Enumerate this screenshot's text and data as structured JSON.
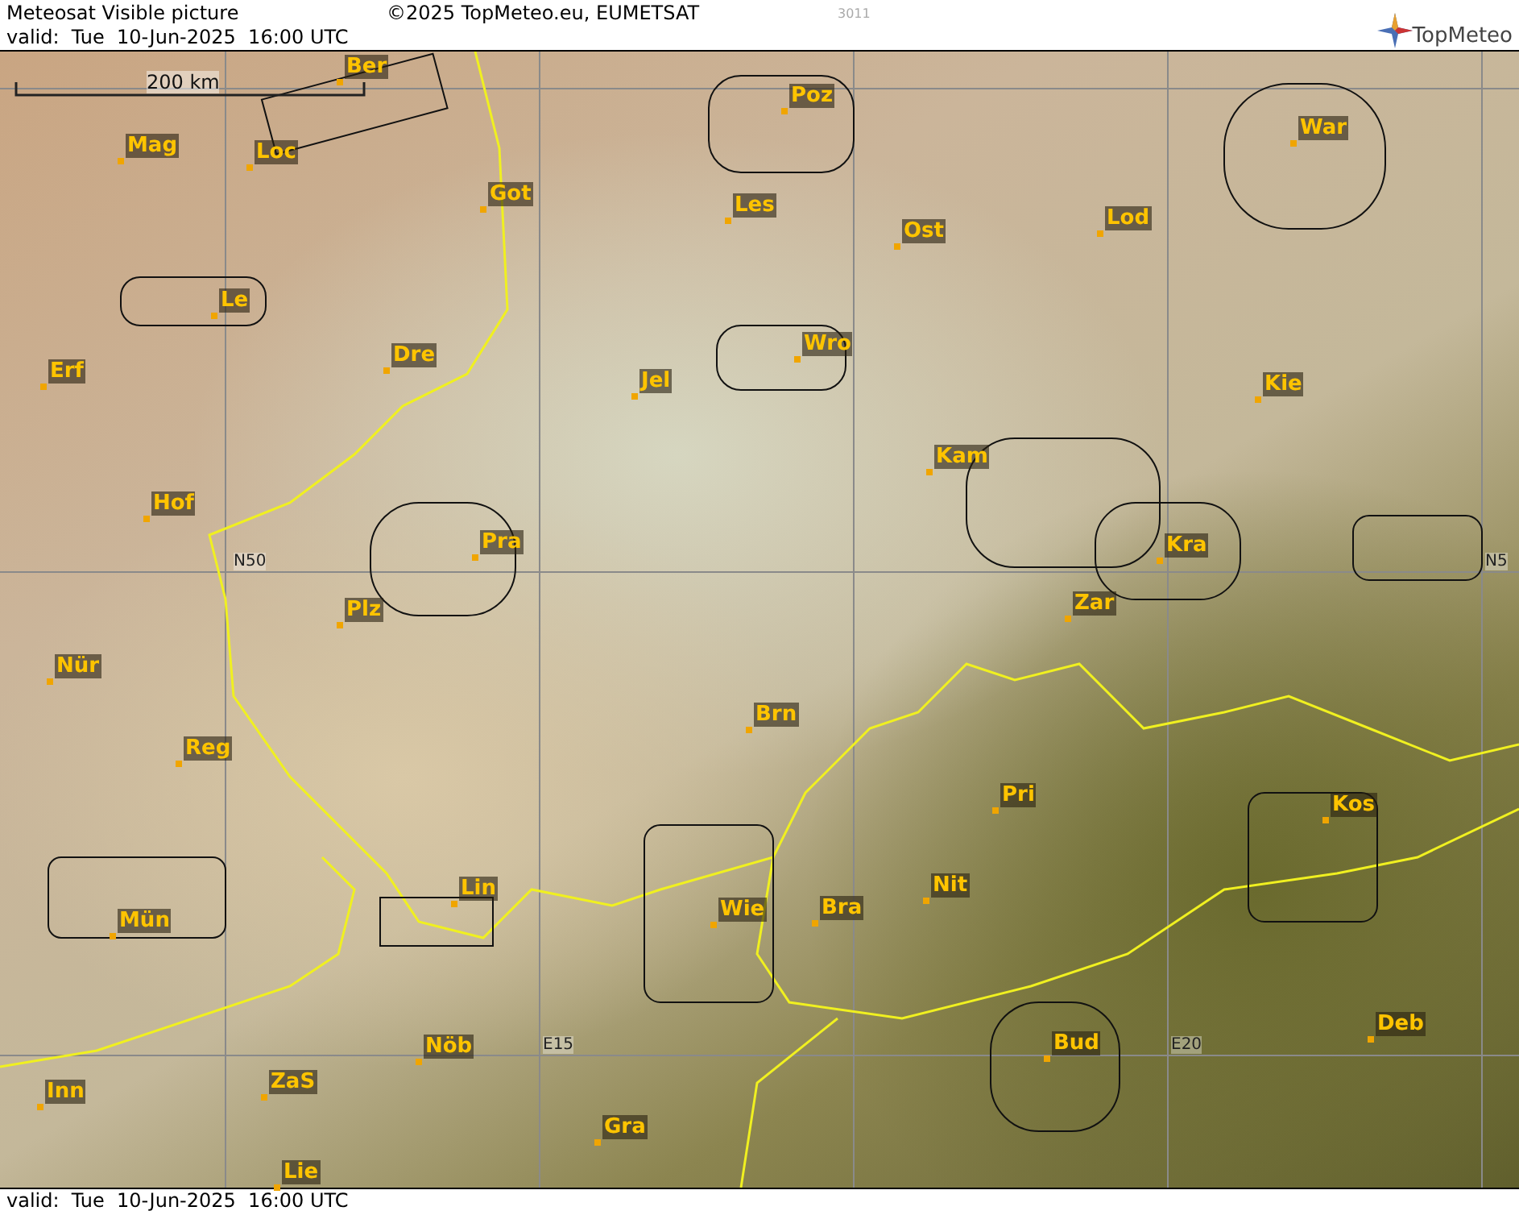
{
  "header": {
    "title": "Meteosat Visible picture",
    "copyright": "©2025 TopMeteo.eu, EUMETSAT",
    "code": "3011",
    "valid": "valid:  Tue  10-Jun-2025  16:00 UTC",
    "logo": "TopMeteo"
  },
  "map": {
    "scale": "200 km",
    "cities": [
      "Ber",
      "Mag",
      "Loc",
      "Got",
      "Poz",
      "War",
      "Les",
      "Ost",
      "Lod",
      "Le",
      "Erf",
      "Dre",
      "Wro",
      "Jel",
      "Kie",
      "Kam",
      "Hof",
      "Pra",
      "Kra",
      "Zar",
      "Plz",
      "Nür",
      "Brn",
      "Reg",
      "Pri",
      "Kos",
      "Lin",
      "Nit",
      "Wie",
      "Bra",
      "Mün",
      "Bud",
      "Deb",
      "Nöb",
      "ZaS",
      "Inn",
      "Gra",
      "Lie"
    ],
    "grid_labels": [
      "N50",
      "N5",
      "E15",
      "E20"
    ]
  },
  "footer": {
    "valid": "valid:  Tue  10-Jun-2025  16:00 UTC"
  }
}
